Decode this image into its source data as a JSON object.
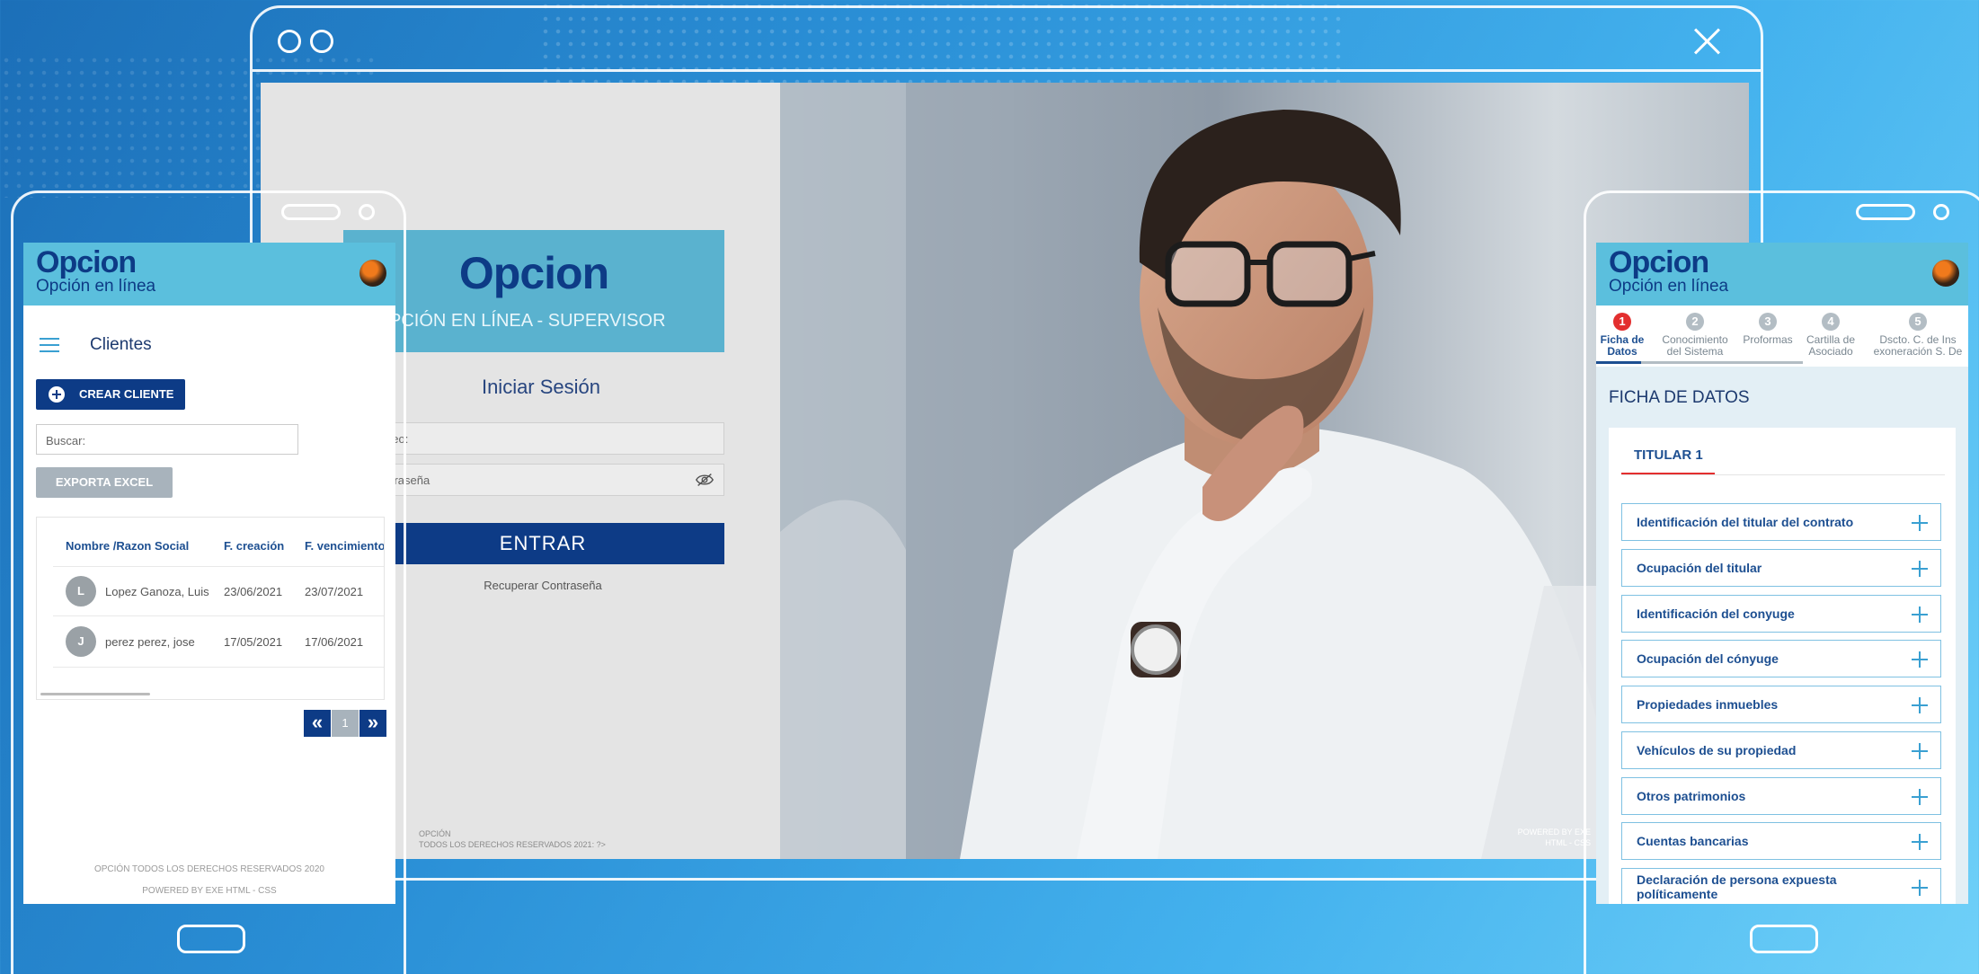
{
  "desktop": {
    "brand": "Opcion",
    "role_title": "OPCIÓN EN LÍNEA - SUPERVISOR",
    "login_title": "Iniciar Sesión",
    "email_placeholder": "Correo:",
    "password_placeholder": "Contraseña",
    "submit_label": "ENTRAR",
    "recover_label": "Recuperar Contraseña",
    "footer_line1": "OPCIÓN",
    "footer_line2": "TODOS LOS DERECHOS RESERVADOS 2021: ?>",
    "powered_line1": "POWERED BY EXE",
    "powered_line2": "HTML - CSS"
  },
  "left_phone": {
    "brand": "Opcion",
    "subtitle": "Opción en línea",
    "page_title": "Clientes",
    "create_button": "CREAR CLIENTE",
    "search_placeholder": "Buscar:",
    "export_button": "EXPORTA EXCEL",
    "table": {
      "headers": [
        "Nombre /Razon Social",
        "F. creación",
        "F. vencimiento"
      ],
      "rows": [
        {
          "initial": "L",
          "name": "Lopez Ganoza, Luis",
          "created": "23/06/2021",
          "expires": "23/07/2021"
        },
        {
          "initial": "J",
          "name": "perez perez, jose",
          "created": "17/05/2021",
          "expires": "17/06/2021"
        }
      ]
    },
    "pagination": {
      "prev": "«",
      "current": "1",
      "next": "»"
    },
    "footer_line1": "OPCIÓN TODOS LOS DERECHOS RESERVADOS 2020",
    "footer_line2": "POWERED BY EXE HTML - CSS"
  },
  "right_phone": {
    "brand": "Opcion",
    "subtitle": "Opción en línea",
    "steps": [
      {
        "num": "1",
        "label_1": "Ficha de",
        "label_2": "Datos"
      },
      {
        "num": "2",
        "label_1": "Conocimiento",
        "label_2": "del Sistema"
      },
      {
        "num": "3",
        "label_1": "Proformas",
        "label_2": ""
      },
      {
        "num": "4",
        "label_1": "Cartilla de",
        "label_2": "Asociado"
      },
      {
        "num": "5",
        "label_1": "Dscto. C. de Ins",
        "label_2": "exoneración S. De"
      }
    ],
    "section_title": "FICHA DE DATOS",
    "tab_label": "TITULAR 1",
    "accordion": [
      "Identificación del titular del contrato",
      "Ocupación del titular",
      "Identificación del conyuge",
      "Ocupación del cónyuge",
      "Propiedades inmuebles",
      "Vehículos de su propiedad",
      "Otros patrimonios",
      "Cuentas bancarias",
      "Declaración de persona expuesta",
      "políticamente"
    ]
  },
  "colors": {
    "brand_navy": "#0d3b86",
    "header_cyan": "#5bbfdd",
    "step_active": "#e32f2f",
    "accent_blue": "#3aa0d2"
  }
}
